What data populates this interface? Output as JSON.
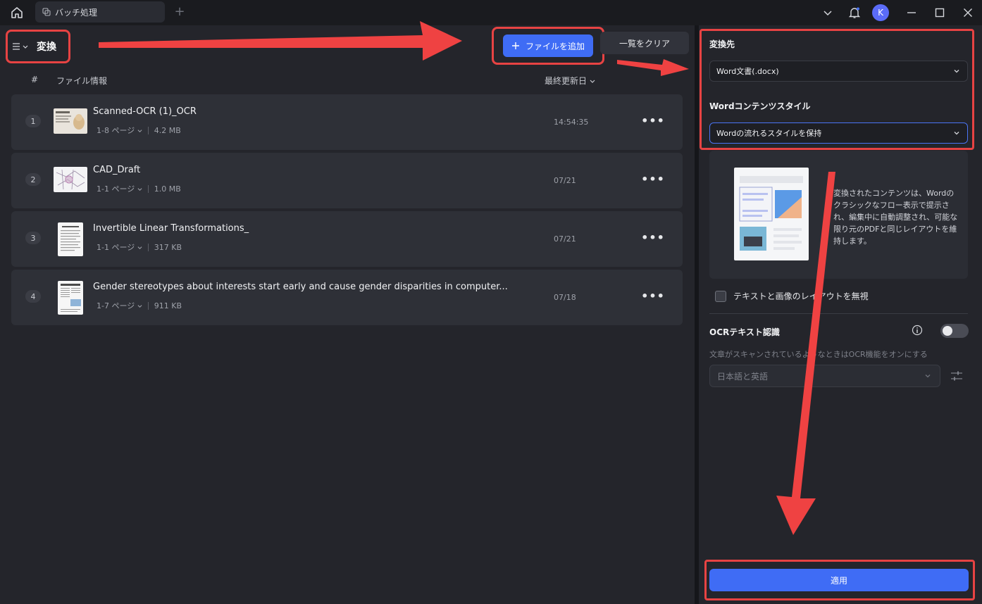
{
  "titlebar": {
    "tab_label": "バッチ処理",
    "tab_add": "+",
    "avatar_initial": "K"
  },
  "toolbar": {
    "mode_title": "変換",
    "add_file_label": "ファイルを追加",
    "clear_list_label": "一覧をクリア"
  },
  "list": {
    "col_num": "#",
    "col_info": "ファイル情報",
    "col_modified": "最終更新日",
    "files": [
      {
        "num": "1",
        "name": "Scanned-OCR (1)_OCR",
        "pages": "1-8 ページ",
        "size": "4.2 MB",
        "date": "14:54:35",
        "more": "•••",
        "thumb_icon": "document-photo-thumbnail"
      },
      {
        "num": "2",
        "name": "CAD_Draft",
        "pages": "1-1 ページ",
        "size": "1.0 MB",
        "date": "07/21",
        "more": "•••",
        "thumb_icon": "cad-drawing-thumbnail"
      },
      {
        "num": "3",
        "name": "Invertible Linear Transformations_",
        "pages": "1-1 ページ",
        "size": "317 KB",
        "date": "07/21",
        "more": "•••",
        "thumb_icon": "text-page-thumbnail"
      },
      {
        "num": "4",
        "name": "Gender stereotypes about interests start early and cause gender disparities in computer...",
        "pages": "1-7 ページ",
        "size": "911 KB",
        "date": "07/18",
        "more": "•••",
        "thumb_icon": "article-page-thumbnail"
      }
    ]
  },
  "settings": {
    "target_label": "変換先",
    "target_value": "Word文書(.docx)",
    "style_label": "Wordコンテンツスタイル",
    "style_value": "Wordの流れるスタイルを保持",
    "style_description": "変換されたコンテンツは、Wordのクラシックなフロー表示で提示され、編集中に自動調整され、可能な限り元のPDFと同じレイアウトを維持します。",
    "ignore_layout_label": "テキストと画像のレイアウトを無視",
    "ignore_layout_checked": false,
    "ocr_title": "OCRテキスト認識",
    "ocr_enabled": false,
    "ocr_description": "文章がスキャンされているようなときはOCR機能をオンにする",
    "ocr_language": "日本語と英語",
    "apply_label": "適用"
  },
  "colors": {
    "accent": "#3f6cf5",
    "highlight": "#e74343",
    "background": "#24252b"
  }
}
